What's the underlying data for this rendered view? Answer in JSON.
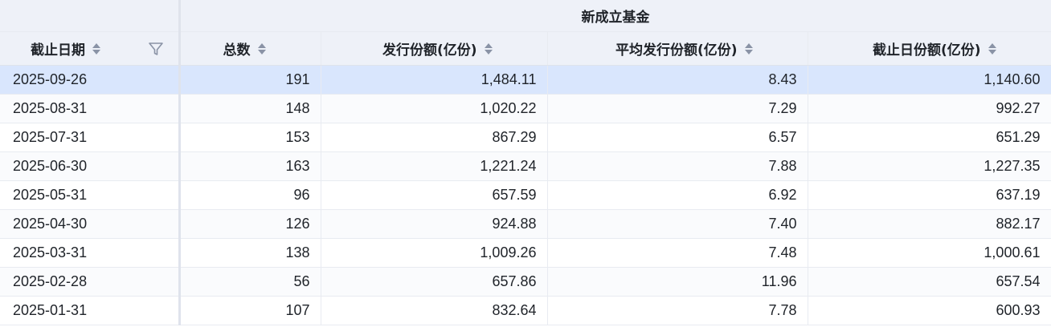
{
  "group_header": "新成立基金",
  "columns": {
    "date": "截止日期",
    "total": "总数",
    "issue_amount": "发行份额(亿份)",
    "avg_issue_amount": "平均发行份额(亿份)",
    "end_amount": "截止日份额(亿份)"
  },
  "rows": [
    {
      "date": "2025-09-26",
      "total": "191",
      "issue_amount": "1,484.11",
      "avg_issue_amount": "8.43",
      "end_amount": "1,140.60"
    },
    {
      "date": "2025-08-31",
      "total": "148",
      "issue_amount": "1,020.22",
      "avg_issue_amount": "7.29",
      "end_amount": "992.27"
    },
    {
      "date": "2025-07-31",
      "total": "153",
      "issue_amount": "867.29",
      "avg_issue_amount": "6.57",
      "end_amount": "651.29"
    },
    {
      "date": "2025-06-30",
      "total": "163",
      "issue_amount": "1,221.24",
      "avg_issue_amount": "7.88",
      "end_amount": "1,227.35"
    },
    {
      "date": "2025-05-31",
      "total": "96",
      "issue_amount": "657.59",
      "avg_issue_amount": "6.92",
      "end_amount": "637.19"
    },
    {
      "date": "2025-04-30",
      "total": "126",
      "issue_amount": "924.88",
      "avg_issue_amount": "7.40",
      "end_amount": "882.17"
    },
    {
      "date": "2025-03-31",
      "total": "138",
      "issue_amount": "1,009.26",
      "avg_issue_amount": "7.48",
      "end_amount": "1,000.61"
    },
    {
      "date": "2025-02-28",
      "total": "56",
      "issue_amount": "657.86",
      "avg_issue_amount": "11.96",
      "end_amount": "657.54"
    },
    {
      "date": "2025-01-31",
      "total": "107",
      "issue_amount": "832.64",
      "avg_issue_amount": "7.78",
      "end_amount": "600.93"
    }
  ],
  "highlight_color": "#d9e6fd"
}
